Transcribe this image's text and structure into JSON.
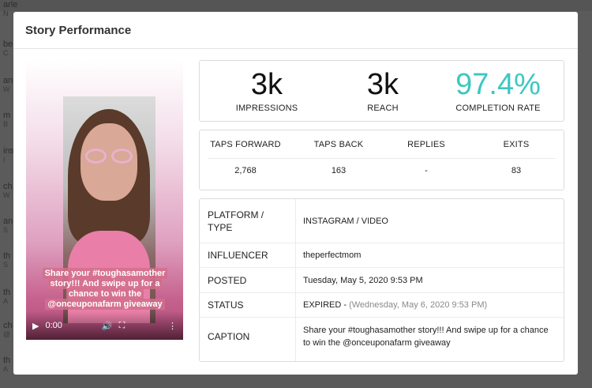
{
  "background": {
    "rows": [
      {
        "name": "arle",
        "sub": "N"
      },
      {
        "name": "be",
        "sub": "C"
      },
      {
        "name": "an",
        "sub": "W"
      },
      {
        "name": "m",
        "sub": "B"
      },
      {
        "name": "ins",
        "sub": "I"
      },
      {
        "name": "ch",
        "sub": "W"
      },
      {
        "name": "an",
        "sub": "S"
      },
      {
        "name": "th",
        "sub": "S"
      },
      {
        "name": "th",
        "sub": "A"
      },
      {
        "name": "ch",
        "sub": "@"
      },
      {
        "name": "th",
        "sub": "A"
      }
    ]
  },
  "modal": {
    "title": "Story Performance"
  },
  "story": {
    "caption_lines": [
      "Share your #toughasamother",
      "story!!! And swipe up for a",
      "chance to win the",
      "@onceuponafarm giveaway"
    ],
    "controls": {
      "play": "▶",
      "time": "0:00",
      "volume": "🔊",
      "fullscreen": "⛶",
      "menu": "⋮"
    }
  },
  "metrics": [
    {
      "value": "3k",
      "label": "IMPRESSIONS"
    },
    {
      "value": "3k",
      "label": "REACH"
    },
    {
      "value": "97.4%",
      "label": "COMPLETION RATE"
    }
  ],
  "taps": {
    "headers": [
      "TAPS FORWARD",
      "TAPS BACK",
      "REPLIES",
      "EXITS"
    ],
    "values": [
      "2,768",
      "163",
      "-",
      "83"
    ]
  },
  "details": {
    "platform_label": "PLATFORM / TYPE",
    "platform_value": "INSTAGRAM / VIDEO",
    "influencer_label": "INFLUENCER",
    "influencer_value": "theperfectmom",
    "posted_label": "POSTED",
    "posted_value": "Tuesday, May 5, 2020 9:53 PM",
    "status_label": "STATUS",
    "status_value": "EXPIRED -",
    "status_expiry": "(Wednesday, May 6, 2020 9:53 PM)",
    "caption_label": "CAPTION",
    "caption_value": "Share your #toughasamother story!!! And swipe up for a chance to win the @onceuponafarm giveaway"
  },
  "colors": {
    "accent_teal": "#3cc7c3"
  }
}
